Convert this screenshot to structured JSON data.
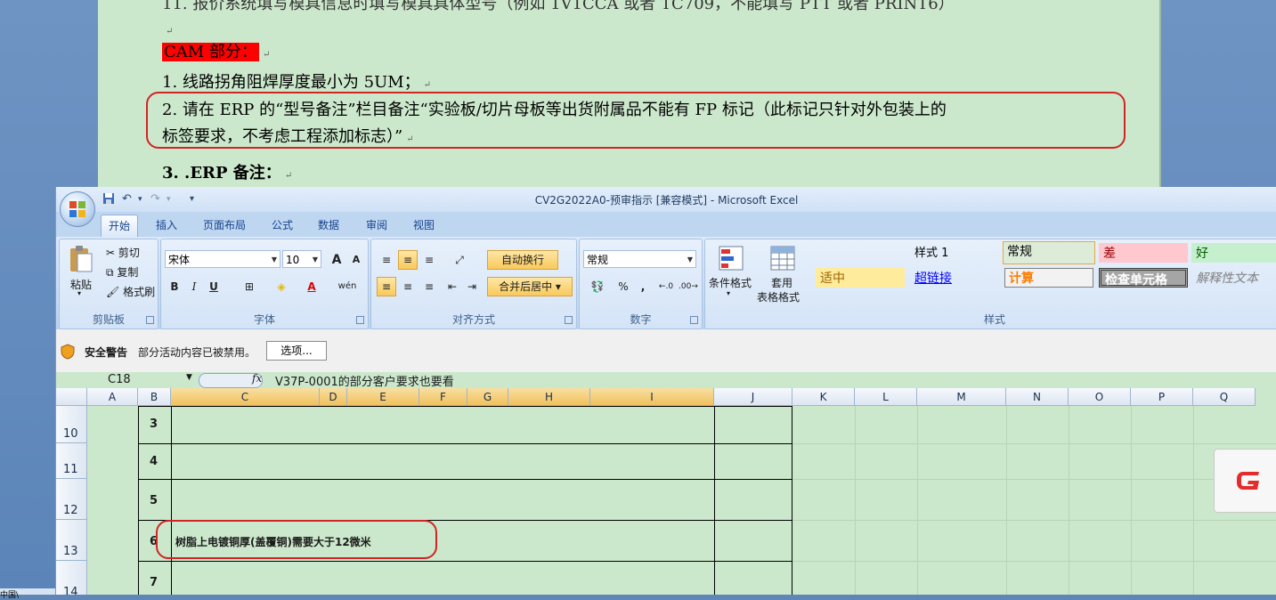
{
  "word_doc": {
    "line_top_cut": "11. 报价系统填写模具信息时填写模具具体型号（例如 1V1CCA 或者 TC709，不能填写 PTT 或者 PRINT6）",
    "cam_section": "CAM 部分：",
    "item1": "1.  线路拐角阻焊厚度最小为 5UM；",
    "item2_line1": "2.  请在 ERP 的“型号备注”栏目备注“实验板/切片母板等出货附属品不能有 FP 标记（此标记只针对外包装上的",
    "item2_line2": "标签要求，不考虑工程添加标志）”",
    "item3": "3. .ERP 备注：",
    "para_mark": "↵"
  },
  "excel": {
    "window_title": "CV2G2022A0-预审指示  [兼容模式] - Microsoft Excel",
    "quick_access": {
      "dropdown": "▾"
    },
    "tabs": [
      "开始",
      "插入",
      "页面布局",
      "公式",
      "数据",
      "审阅",
      "视图"
    ],
    "ribbon": {
      "clipboard": {
        "label": "剪贴板",
        "paste": "粘贴",
        "cut": "剪切",
        "copy": "复制",
        "format_painter": "格式刷"
      },
      "font": {
        "label": "字体",
        "font_name": "宋体",
        "font_size": "10",
        "bold": "B",
        "italic": "I",
        "underline": "U",
        "grow": "A",
        "shrink": "A",
        "phonetic": "wén"
      },
      "alignment": {
        "label": "对齐方式",
        "wrap_text": "自动换行",
        "merge_center": "合并后居中"
      },
      "number": {
        "label": "数字",
        "format": "常规",
        "percent": "%",
        "comma": ","
      },
      "styles": {
        "label": "样式",
        "conditional": "条件格式",
        "table_format_1": "套用",
        "table_format_2": "表格格式",
        "cells": [
          {
            "text": "",
            "bg": "#cce8cc",
            "color": "#000000"
          },
          {
            "text": "样式 1",
            "bg": "#cce8cc",
            "color": "#000000"
          },
          {
            "text": "常规",
            "bg": "#cce8cc",
            "color": "#000000"
          },
          {
            "text": "差",
            "bg": "#ffc7ce",
            "color": "#9c0006"
          },
          {
            "text": "好",
            "bg": "#c6efce",
            "color": "#006100"
          },
          {
            "text": "适中",
            "bg": "#ffeb9c",
            "color": "#9c6500"
          },
          {
            "text": "超链接",
            "bg": "#cce8cc",
            "color": "#0000ff"
          },
          {
            "text": "计算",
            "bg": "#f2f2f2",
            "color": "#fa7d00"
          },
          {
            "text": "检查单元格",
            "bg": "#a5a5a5",
            "color": "#ffffff"
          },
          {
            "text": "解释性文本",
            "bg": "#cce8cc",
            "color": "#7f7f7f"
          }
        ]
      }
    },
    "security": {
      "title": "安全警告",
      "message": "部分活动内容已被禁用。",
      "options_button": "选项..."
    },
    "formula": {
      "name_box": "C18",
      "fx": "fx",
      "content": "V37P-0001的部分客户要求也要看"
    },
    "columns": [
      "A",
      "B",
      "C",
      "D",
      "E",
      "F",
      "G",
      "H",
      "I",
      "J",
      "K",
      "L",
      "M",
      "N",
      "O",
      "P",
      "Q"
    ],
    "rows": [
      {
        "num": "10",
        "b": "3",
        "c": ""
      },
      {
        "num": "11",
        "b": "4",
        "c": ""
      },
      {
        "num": "12",
        "b": "5",
        "c": ""
      },
      {
        "num": "13",
        "b": "6",
        "c": "树脂上电镀铜厚(盖覆铜)需要大于12微米"
      },
      {
        "num": "14",
        "b": "7",
        "c": ""
      }
    ]
  },
  "taskbar": {
    "item": "中国\\"
  }
}
